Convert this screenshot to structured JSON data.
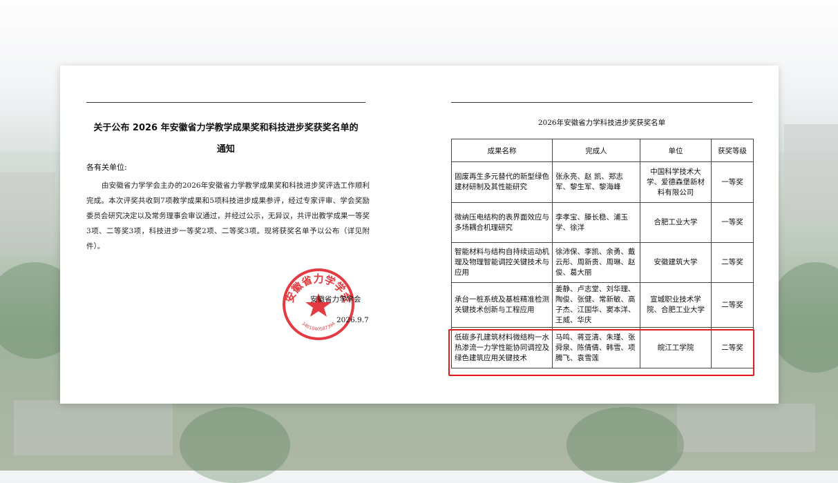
{
  "notice": {
    "title_line1": "关于公布 2026 年安徽省力学教学成果奖和科技进步奖获奖名单的",
    "title_line2": "通知",
    "salutation": "各有关单位:",
    "body": "由安徽省力学学会主办的2026年安徽省力学教学成果奖和科技进步奖评选工作顺利完成。本次评奖共收到7项教学成果和5项科技进步成果参评，经过专家评审、学会奖励委员会研究决定以及常务理事会审议通过，并经过公示，无异议，共评出教学成果一等奖3项、二等奖3项，科技进步一等奖2项、二等奖3项。现将获奖名单予以公布（详见附件）。",
    "signer": "安徽省力学学会",
    "date": "2026.9.7"
  },
  "seal": {
    "text": "安徽省力学学会",
    "code": "3401040587394",
    "color": "#e0262c"
  },
  "award_list": {
    "title": "2026年安徽省力学科技进步奖获奖名单",
    "headers": [
      "成果名称",
      "完成人",
      "单位",
      "获奖等级"
    ],
    "rows": [
      {
        "name": "固废再生多元替代的新型绿色建材研制及其性能研究",
        "people": "张永亮、赵 凯、郑志军、黎生军、黎海峰",
        "unit": "中国科学技术大学、爱德森堡新材料有限公司",
        "level": "一等奖"
      },
      {
        "name": "微纳压电结构的表界面效应与多场耦合机理研究",
        "people": "李孝宝、滕长稳、浦玉学、徐洋",
        "unit": "合肥工业大学",
        "level": "一等奖"
      },
      {
        "name": "智能材料与结构自持续运动机理及物理智能调控关键技术与应用",
        "people": "徐沛保、李凯、余勇、戴云彤、周新贵、周琳、赵俊、葛大丽",
        "unit": "安徽建筑大学",
        "level": "二等奖"
      },
      {
        "name": "承台一桩系统及基桩精准检测关键技术创新与工程应用",
        "people": "姜静、卢志堂、刘华理、陶俊、张健、常新敏、高子杰、江国华、窦本洋、王威、华庆",
        "unit": "宣城职业技术学院、合肥工业大学",
        "level": "二等奖"
      },
      {
        "name": "低碳多孔建筑材料微结构一水热渗流一力学性能协同调控及绿色建筑应用关键技术",
        "people": "马鸣、蒋亚清、朱瑾、张舜泉、陈倩倩、韩雪、项腾飞、袁雪莲",
        "unit": "皖江工学院",
        "level": "二等奖"
      }
    ]
  },
  "highlight": {
    "color": "#e01b1b"
  }
}
